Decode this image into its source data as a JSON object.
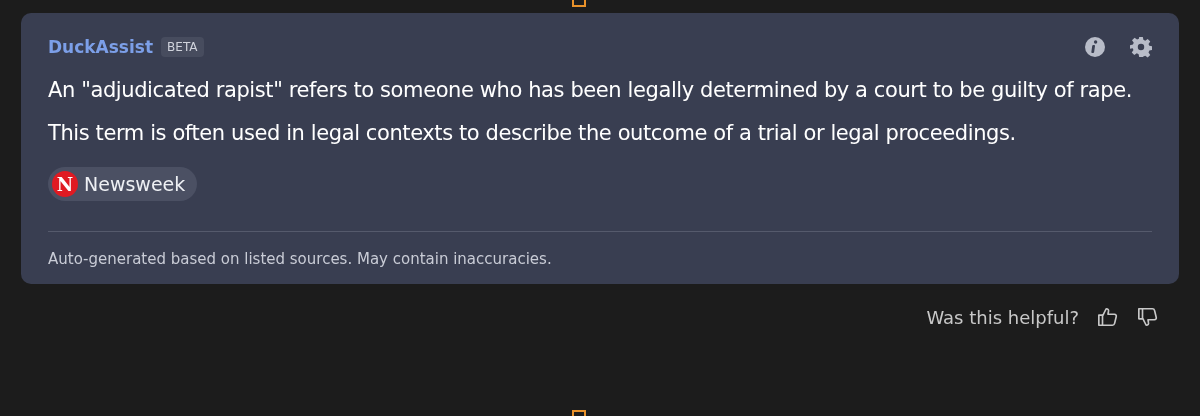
{
  "card": {
    "title": "DuckAssist",
    "badge": "BETA",
    "answer": "An \"adjudicated rapist\" refers to someone who has been legally determined by a court to be guilty of rape. This term is often used in legal contexts to describe the outcome of a trial or legal proceedings.",
    "sources": [
      {
        "logo_letter": "N",
        "name": "Newsweek",
        "color": "#e01a22"
      }
    ],
    "disclaimer": "Auto-generated based on listed sources. May contain inaccuracies."
  },
  "feedback": {
    "question": "Was this helpful?"
  }
}
